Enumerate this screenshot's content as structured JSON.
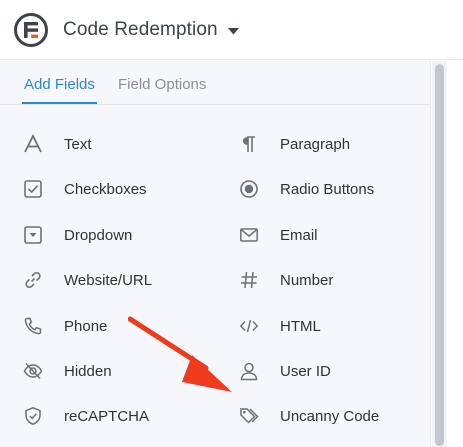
{
  "header": {
    "form_title": "Code Redemption"
  },
  "tabs": {
    "add_fields": "Add Fields",
    "field_options": "Field Options"
  },
  "fields": [
    {
      "label": "Text",
      "icon": "text-icon"
    },
    {
      "label": "Paragraph",
      "icon": "paragraph-icon"
    },
    {
      "label": "Checkboxes",
      "icon": "checkbox-icon"
    },
    {
      "label": "Radio Buttons",
      "icon": "radio-icon"
    },
    {
      "label": "Dropdown",
      "icon": "dropdown-icon"
    },
    {
      "label": "Email",
      "icon": "email-icon"
    },
    {
      "label": "Website/URL",
      "icon": "link-icon"
    },
    {
      "label": "Number",
      "icon": "hash-icon"
    },
    {
      "label": "Phone",
      "icon": "phone-icon"
    },
    {
      "label": "HTML",
      "icon": "code-icon"
    },
    {
      "label": "Hidden",
      "icon": "eye-slash-icon"
    },
    {
      "label": "User ID",
      "icon": "user-icon"
    },
    {
      "label": "reCAPTCHA",
      "icon": "shield-icon"
    },
    {
      "label": "Uncanny Code",
      "icon": "tags-icon"
    }
  ],
  "colors": {
    "accent": "#2d86d6",
    "arrow": "#f03a1e",
    "logo_orange": "#f05a24"
  }
}
